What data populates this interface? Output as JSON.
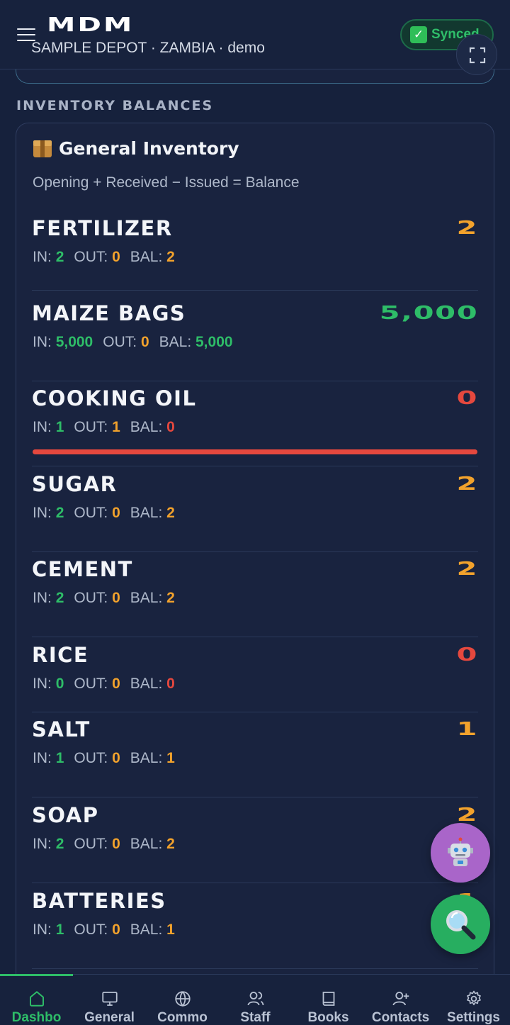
{
  "header": {
    "brand": "MDM",
    "subtitle": "SAMPLE DEPOT · ZAMBIA · demo",
    "sync_label": "Synced"
  },
  "section_title": "INVENTORY BALANCES",
  "card": {
    "title": "General Inventory",
    "formula": "Opening + Received − Issued = Balance"
  },
  "stat_labels": {
    "in": "IN:",
    "out": "OUT:",
    "bal": "BAL:"
  },
  "items": [
    {
      "name": "FERTILIZER",
      "total": "2",
      "in": "2",
      "out": "0",
      "bal": "2",
      "status": "ok"
    },
    {
      "name": "MAIZE BAGS",
      "total": "5,000",
      "in": "5,000",
      "out": "0",
      "bal": "5,000",
      "status": "high"
    },
    {
      "name": "COOKING OIL",
      "total": "0",
      "in": "1",
      "out": "1",
      "bal": "0",
      "status": "empty-alert"
    },
    {
      "name": "SUGAR",
      "total": "2",
      "in": "2",
      "out": "0",
      "bal": "2",
      "status": "ok"
    },
    {
      "name": "CEMENT",
      "total": "2",
      "in": "2",
      "out": "0",
      "bal": "2",
      "status": "ok"
    },
    {
      "name": "RICE",
      "total": "0",
      "in": "0",
      "out": "0",
      "bal": "0",
      "status": "empty"
    },
    {
      "name": "SALT",
      "total": "1",
      "in": "1",
      "out": "0",
      "bal": "1",
      "status": "ok"
    },
    {
      "name": "SOAP",
      "total": "2",
      "in": "2",
      "out": "0",
      "bal": "2",
      "status": "ok"
    },
    {
      "name": "BATTERIES",
      "total": "1",
      "in": "1",
      "out": "0",
      "bal": "1",
      "status": "ok"
    }
  ],
  "fabs": {
    "assistant_icon": "robot-icon",
    "search_icon": "magnifier-icon"
  },
  "nav": [
    {
      "label": "Dashbo",
      "icon": "home-icon",
      "active": true
    },
    {
      "label": "General",
      "icon": "monitor-icon"
    },
    {
      "label": "Commo",
      "icon": "globe-icon"
    },
    {
      "label": "Staff",
      "icon": "users-icon"
    },
    {
      "label": "Books",
      "icon": "book-icon"
    },
    {
      "label": "Contacts",
      "icon": "user-plus-icon"
    },
    {
      "label": "Settings",
      "icon": "gear-icon"
    }
  ],
  "colors": {
    "background": "#16213c",
    "green": "#2ebd68",
    "orange": "#f2a22c",
    "red": "#e5483e",
    "assistant_fab": "#a965c9",
    "search_fab": "#27ae60"
  }
}
